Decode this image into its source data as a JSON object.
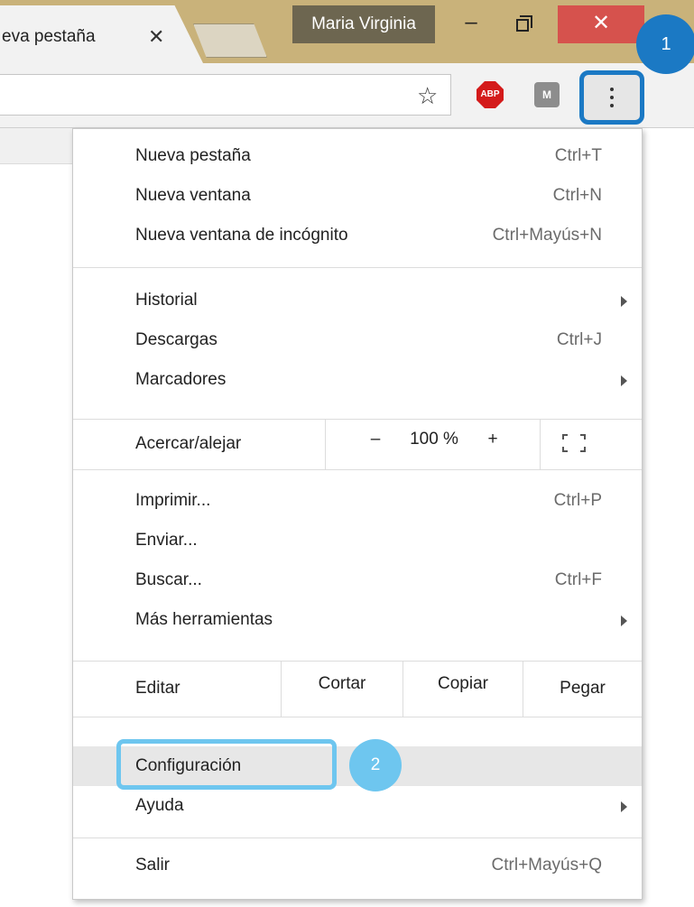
{
  "window": {
    "tab_title": "eva pestaña",
    "tab_close_glyph": "✕",
    "profile_name": "Maria Virginia",
    "minimize_glyph": "–",
    "close_glyph": "✕"
  },
  "toolbar": {
    "star_glyph": "☆",
    "abp_label": "ABP",
    "ext2_label": "M"
  },
  "annotations": {
    "step1": "1",
    "step2": "2"
  },
  "menu": {
    "new_tab": {
      "label": "Nueva pestaña",
      "shortcut": "Ctrl+T"
    },
    "new_window": {
      "label": "Nueva ventana",
      "shortcut": "Ctrl+N"
    },
    "incognito": {
      "label": "Nueva ventana de incógnito",
      "shortcut": "Ctrl+Mayús+N"
    },
    "history": {
      "label": "Historial"
    },
    "downloads": {
      "label": "Descargas",
      "shortcut": "Ctrl+J"
    },
    "bookmarks": {
      "label": "Marcadores"
    },
    "zoom": {
      "label": "Acercar/alejar",
      "minus": "–",
      "value": "100 %",
      "plus": "+"
    },
    "print": {
      "label": "Imprimir...",
      "shortcut": "Ctrl+P"
    },
    "send": {
      "label": "Enviar..."
    },
    "find": {
      "label": "Buscar...",
      "shortcut": "Ctrl+F"
    },
    "more_tools": {
      "label": "Más herramientas"
    },
    "edit": {
      "label": "Editar",
      "cut": "Cortar",
      "copy": "Copiar",
      "paste": "Pegar"
    },
    "settings": {
      "label": "Configuración"
    },
    "help": {
      "label": "Ayuda"
    },
    "exit": {
      "label": "Salir",
      "shortcut": "Ctrl+Mayús+Q"
    }
  },
  "colors": {
    "annotation_dark": "#1b79c4",
    "annotation_light": "#6ec6ef",
    "window_close_red": "#d6524d",
    "title_bar": "#c9b27a"
  }
}
